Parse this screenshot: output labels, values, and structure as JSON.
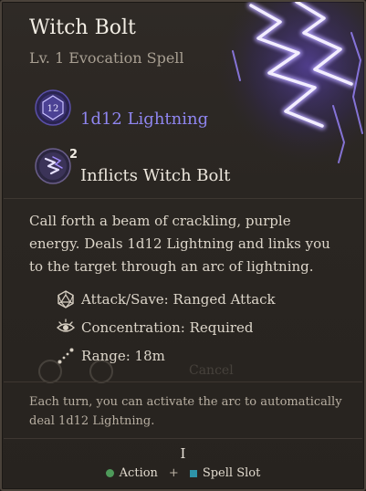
{
  "spell": {
    "name": "Witch Bolt",
    "subtitle": "Lv. 1 Evocation Spell",
    "damage": "1d12 Lightning",
    "die_label": "12",
    "condition": {
      "label": "Inflicts Witch Bolt",
      "count": "2"
    },
    "description": "Call forth a beam of crackling, purple energy. Deals 1d12 Lightning and links you to the target through an arc of lightning.",
    "properties": [
      {
        "icon": "d20-icon",
        "label": "Attack/Save: Ranged Attack"
      },
      {
        "icon": "concentration-eye-icon",
        "label": "Concentration: Required"
      },
      {
        "icon": "range-icon",
        "label": "Range: 18m"
      }
    ],
    "ghost_text": "Cancel",
    "extra_text": "Each turn, you can activate the arc to automatically deal 1d12 Lightning.",
    "level_roman": "I",
    "cost": {
      "action": "Action",
      "plus": "+",
      "spell_slot": "Spell Slot"
    }
  },
  "colors": {
    "damage_lightning": "#8f86f0",
    "action_dot": "#4e9a5a",
    "spell_slot_square": "#2e93a8",
    "art_glow": "#8a6cff"
  }
}
